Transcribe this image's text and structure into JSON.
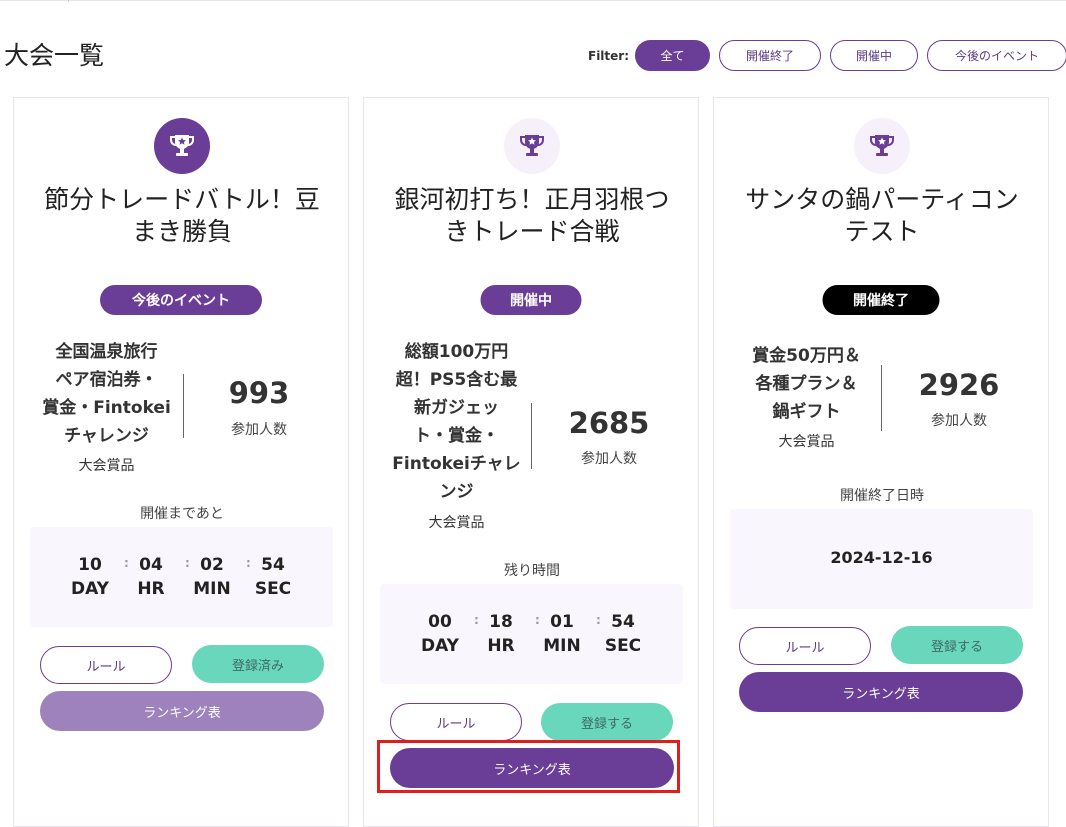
{
  "page": {
    "title": "大会一覧"
  },
  "filter": {
    "label": "Filter:",
    "options": [
      "全て",
      "開催終了",
      "開催中",
      "今後のイベント"
    ],
    "active_index": 0
  },
  "colors": {
    "accent": "#6a3d97",
    "register_green": "#69d7bc",
    "ended_badge": "#000000",
    "highlight_red": "#e21d1d"
  },
  "cards": [
    {
      "title_lines": [
        "節分トレードバトル！豆",
        "まき勝負"
      ],
      "status": "今後のイベント",
      "prize_lines": [
        "全国温泉旅行",
        "ペア宿泊券・",
        "賞金・Fintokei",
        "チャレンジ"
      ],
      "prize_caption": "大会賞品",
      "participants": "993",
      "participants_label": "参加人数",
      "timer_label": "開催まであと",
      "timer": {
        "day": "10",
        "hr": "04",
        "min": "02",
        "sec": "54"
      },
      "units": {
        "day": "DAY",
        "hr": "HR",
        "min": "MIN",
        "sec": "SEC"
      },
      "separator": ":",
      "buttons": {
        "rule": "ルール",
        "register": "登録済み",
        "ranking": "ランキング表"
      }
    },
    {
      "title_lines": [
        "銀河初打ち！正月羽根つ",
        "きトレード合戦"
      ],
      "status": "開催中",
      "prize_lines": [
        "総額100万円",
        "超！PS5含む最",
        "新ガジェッ",
        "ト・賞金・",
        "Fintokeiチャレ",
        "ンジ"
      ],
      "prize_caption": "大会賞品",
      "participants": "2685",
      "participants_label": "参加人数",
      "timer_label": "残り時間",
      "timer": {
        "day": "00",
        "hr": "18",
        "min": "01",
        "sec": "54"
      },
      "units": {
        "day": "DAY",
        "hr": "HR",
        "min": "MIN",
        "sec": "SEC"
      },
      "separator": ":",
      "buttons": {
        "rule": "ルール",
        "register": "登録する",
        "ranking": "ランキング表"
      }
    },
    {
      "title_lines": [
        "サンタの鍋パーティコン",
        "テスト"
      ],
      "status": "開催終了",
      "prize_lines": [
        "賞金50万円＆",
        "各種プラン＆",
        "鍋ギフト"
      ],
      "prize_caption": "大会賞品",
      "participants": "2926",
      "participants_label": "参加人数",
      "end_date_label": "開催終了日時",
      "end_date": "2024-12-16",
      "buttons": {
        "rule": "ルール",
        "register": "登録する",
        "ranking": "ランキング表"
      }
    }
  ]
}
